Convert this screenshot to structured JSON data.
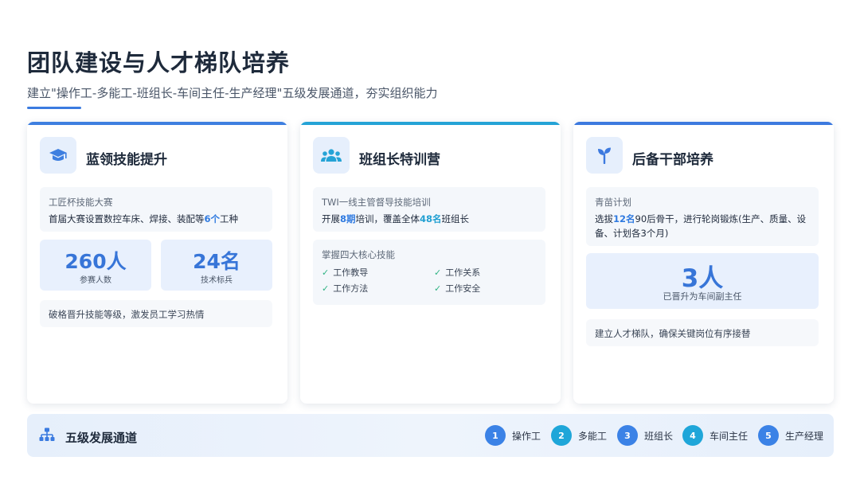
{
  "header": {
    "title": "团队建设与人才梯队培养",
    "subtitle": "建立\"操作工-多能工-班组长-车间主任-生产经理\"五级发展通道，夯实组织能力"
  },
  "cards": [
    {
      "icon": "graduation-cap-icon",
      "title": "蓝领技能提升",
      "box_label": "工匠杯技能大赛",
      "box_desc_pre": "首届大赛设置数控车床、焊接、装配等",
      "box_desc_hl": "6个",
      "box_desc_post": "工种",
      "stats": [
        {
          "value": "260人",
          "caption": "参赛人数"
        },
        {
          "value": "24名",
          "caption": "技术标兵"
        }
      ],
      "note": "破格晋升技能等级，激发员工学习热情"
    },
    {
      "icon": "users-icon",
      "title": "班组长特训营",
      "box_label": "TWI一线主管督导技能培训",
      "box_desc_a": "开展",
      "box_desc_hl1": "8期",
      "box_desc_b": "培训，覆盖全体",
      "box_desc_hl2": "48名",
      "box_desc_c": "班组长",
      "skills_label": "掌握四大核心技能",
      "skills": [
        "工作教导",
        "工作关系",
        "工作方法",
        "工作安全"
      ]
    },
    {
      "icon": "sprout-icon",
      "title": "后备干部培养",
      "box_label": "青苗计划",
      "box_desc_a": "选拔",
      "box_desc_hl": "12名",
      "box_desc_b": "90后骨干，进行轮岗锻炼(生产、质量、设备、计划各3个月)",
      "big_value": "3人",
      "big_caption": "已晋升为车间副主任",
      "note": "建立人才梯队，确保关键岗位有序接替"
    }
  ],
  "bottom": {
    "icon": "org-chart-icon",
    "title": "五级发展通道",
    "steps": [
      {
        "num": "1",
        "label": "操作工",
        "color": "#3b82e6"
      },
      {
        "num": "2",
        "label": "多能工",
        "color": "#1fa6d9"
      },
      {
        "num": "3",
        "label": "班组长",
        "color": "#3b82e6"
      },
      {
        "num": "4",
        "label": "车间主任",
        "color": "#1fa6d9"
      },
      {
        "num": "5",
        "label": "生产经理",
        "color": "#3b82e6"
      }
    ]
  }
}
